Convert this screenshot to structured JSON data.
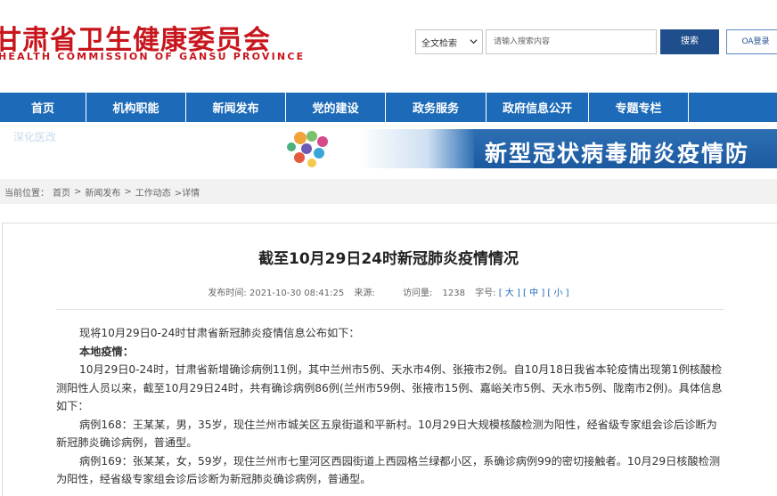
{
  "header": {
    "logo_cn": "甘肃省卫生健康委员会",
    "logo_en": "HEALTH COMMISSION OF GANSU PROVINCE",
    "search_scope": "全文检索",
    "search_placeholder": "请输入搜索内容",
    "search_button": "搜索",
    "oa_button": "OA登录"
  },
  "nav": {
    "items": [
      {
        "label": "首页",
        "width": 97
      },
      {
        "label": "机构职能",
        "width": 112
      },
      {
        "label": "新闻发布",
        "width": 112
      },
      {
        "label": "党的建设",
        "width": 112
      },
      {
        "label": "政务服务",
        "width": 113
      },
      {
        "label": "政府信息公开",
        "width": 115
      },
      {
        "label": "专题专栏",
        "width": 112
      }
    ]
  },
  "subbar": {
    "text": "深化医改"
  },
  "banner": {
    "title": "新型冠状病毒肺炎疫情防"
  },
  "breadcrumb": {
    "label": "当前位置：",
    "home": "首页",
    "sep1": ">",
    "news": "新闻发布",
    "sep2": ">",
    "work": "工作动态",
    "sep3": ">详情"
  },
  "article": {
    "title": "截至10月29日24时新冠肺炎疫情情况",
    "meta_time_label": "发布时间:",
    "meta_time": "2021-10-30 08:41:25",
    "meta_source_label": "来源:",
    "meta_visits_label": "访问量:",
    "meta_visits": "1238",
    "meta_size_label": "字号:",
    "size_large": "大",
    "size_medium": "中",
    "size_small": "小",
    "paragraphs": [
      "现将10月29日0-24时甘肃省新冠肺炎疫情信息公布如下：",
      "本地疫情：",
      "10月29日0-24时，甘肃省新增确诊病例11例，其中兰州市5例、天水市4例、张掖市2例。自10月18日我省本轮疫情出现第1例核酸检测阳性人员以来，截至10月29日24时，共有确诊病例86例(兰州市59例、张掖市15例、嘉峪关市5例、天水市5例、陇南市2例)。具体信息如下：",
      "病例168：王某某，男，35岁，现住兰州市城关区五泉街道和平新村。10月29日大规模核酸检测为阳性，经省级专家组会诊后诊断为新冠肺炎确诊病例，普通型。",
      "病例169：张某某，女，59岁，现住兰州市七里河区西园街道上西园格兰绿都小区，系确诊病例99的密切接触者。10月29日核酸检测为阳性，经省级专家组会诊后诊断为新冠肺炎确诊病例，普通型。"
    ]
  }
}
